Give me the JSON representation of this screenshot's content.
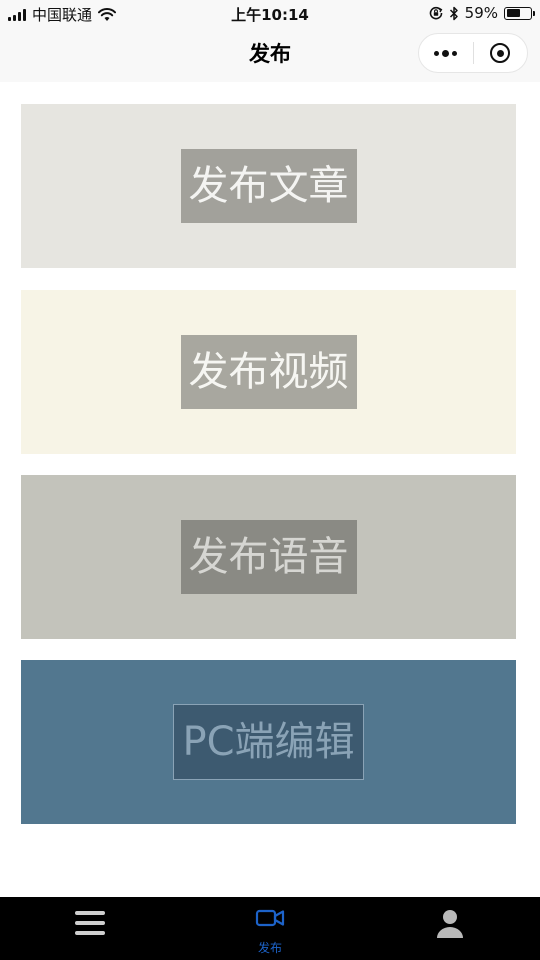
{
  "status_bar": {
    "carrier": "中国联通",
    "time": "上午10:14",
    "battery_percent": "59%",
    "battery_level": 0.59,
    "icons": [
      "signal-icon",
      "wifi-icon",
      "rotation-lock-icon",
      "bluetooth-icon",
      "battery-icon"
    ]
  },
  "nav": {
    "title": "发布",
    "more_icon": "more-dots-icon",
    "close_icon": "close-mini-program-icon"
  },
  "cards": [
    {
      "label": "发布文章"
    },
    {
      "label": "发布视频"
    },
    {
      "label": "发布语音"
    },
    {
      "label": "PC端编辑"
    }
  ],
  "colors": {
    "card_article": "#e6e5e0",
    "card_video": "#f7f4e6",
    "card_audio": "#c3c3bb",
    "card_pc": "#52778f",
    "tab_bar": "#000000",
    "tab_active": "#1d63c9"
  },
  "tab_bar": {
    "items": [
      {
        "icon": "menu-icon",
        "label": ""
      },
      {
        "icon": "publish-video-icon",
        "label": "发布"
      },
      {
        "icon": "profile-icon",
        "label": ""
      }
    ]
  }
}
